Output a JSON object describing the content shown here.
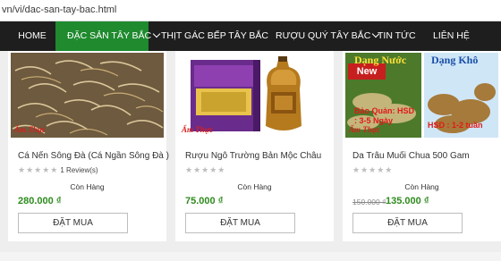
{
  "browser": {
    "url": "vn/vi/dac-san-tay-bac.html"
  },
  "nav": {
    "items": [
      {
        "label": "HOME"
      },
      {
        "label": "ĐẶC SẢN TÂY BẮC",
        "active": true,
        "has_caret": true
      },
      {
        "label": "THỊT GÁC BẾP TÂY BẮC"
      },
      {
        "label": "RƯỢU QUÝ TÂY BẮC",
        "has_caret": true
      },
      {
        "label": "TIN TỨC"
      },
      {
        "label": "LIÊN HỆ"
      }
    ]
  },
  "colors": {
    "accent": "#1f8a2e",
    "price": "#2e8b1e",
    "navbar": "#1e1e1e"
  },
  "products": [
    {
      "title": "Cá Nến Sông Đà (Cá Ngần Sông Đà )",
      "rating_stars": "★★★★★",
      "reviews": "1 Review(s)",
      "stock": "Còn Hàng",
      "price": "280.000 ₫",
      "buy_label": "ĐẶT MUA",
      "image_watermark": "Ẩm Thực"
    },
    {
      "title": "Rượu Ngô Trường Bản Mộc Châu",
      "rating_stars": "★★★★★",
      "stock": "Còn Hàng",
      "price": "75.000 ₫",
      "buy_label": "ĐẶT MUA",
      "image_watermark": "Ẩm Thực"
    },
    {
      "title": "Da Trâu Muối Chua 500 Gam",
      "rating_stars": "★★★★★",
      "stock": "Còn Hàng",
      "price_old": "150.000 ₫",
      "price": "135.000 ₫",
      "buy_label": "ĐẶT MUA",
      "image_badge": "New",
      "image_text_left": "Dạng Nước",
      "image_text_right": "Dạng Khô",
      "image_note_left": "Bảo Quản: HSD : 3-5 Ngày",
      "image_note_right": "HSD : 1-2 tuần",
      "image_watermark": "Ẩm Thực"
    }
  ]
}
